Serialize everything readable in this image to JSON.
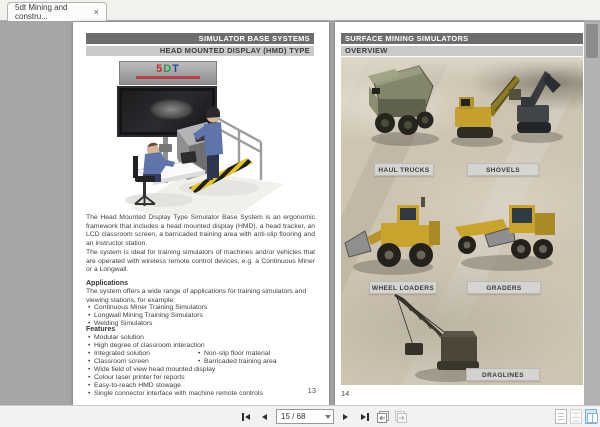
{
  "tab": {
    "title": "5dt Mining and constru...",
    "close_glyph": "×"
  },
  "left_page": {
    "header_bar": "SIMULATOR BASE SYSTEMS",
    "subheader_bar": "HEAD MOUNTED DISPLAY (HMD) TYPE",
    "illustration": {
      "logo_5": "5",
      "logo_d": "D",
      "logo_t": "T"
    },
    "paragraphs": [
      "The Head Mounted Display Type Simulator Base System is an ergonomic framework that includes a head mounted display (HMD), a head tracker, an LCD classroom screen, a barricaded training area with anti-slip flooring and an instructor station.",
      "The system is ideal for training simulators of machines and/or vehicles that are operated with wireless remote control devices, e.g. a Continuous Miner or a Longwall."
    ],
    "applications": {
      "heading": "Applications",
      "intro": "The system offers a wide range of applications for training simulators and viewing stations, for example:",
      "items": [
        "Continuous Miner Training Simulators",
        "Longwall Mining Training Simulators",
        "Welding Simulators"
      ]
    },
    "features": {
      "heading": "Features",
      "rows": [
        {
          "l": "Modular solution"
        },
        {
          "l": "High degree of classroom interaction"
        },
        {
          "l": "Integrated solution",
          "r": "Non-slip floor material"
        },
        {
          "l": "Classroom screen",
          "r": "Barricaded training area"
        },
        {
          "l": "Wide field of view head mounted display"
        },
        {
          "l": "Colour laser printer for reports"
        },
        {
          "l": "Easy-to-reach HMD stowage"
        },
        {
          "l": "Single connector interface with machine remote controls"
        }
      ]
    },
    "page_number": "13"
  },
  "right_page": {
    "header_bar": "SURFACE MINING SIMULATORS",
    "subheader_bar": "OVERVIEW",
    "labels": {
      "haul_trucks": "HAUL TRUCKS",
      "shovels": "SHOVELS",
      "wheel_loaders": "WHEEL LOADERS",
      "graders": "GRADERS",
      "draglines": "DRAGLINES"
    },
    "page_number": "14"
  },
  "toolbar": {
    "page_field": "15 / 68"
  },
  "colors": {
    "header_dark": "#6d6d6f",
    "header_light": "#c9c9cb",
    "viewer_background": "#a6a6a6",
    "label_background": "#d5d5d2",
    "selected_view_blue": "#7ab0e0",
    "logo_red": "#c0272d",
    "logo_green": "#2e9a47",
    "logo_blue": "#1f4fa0"
  }
}
